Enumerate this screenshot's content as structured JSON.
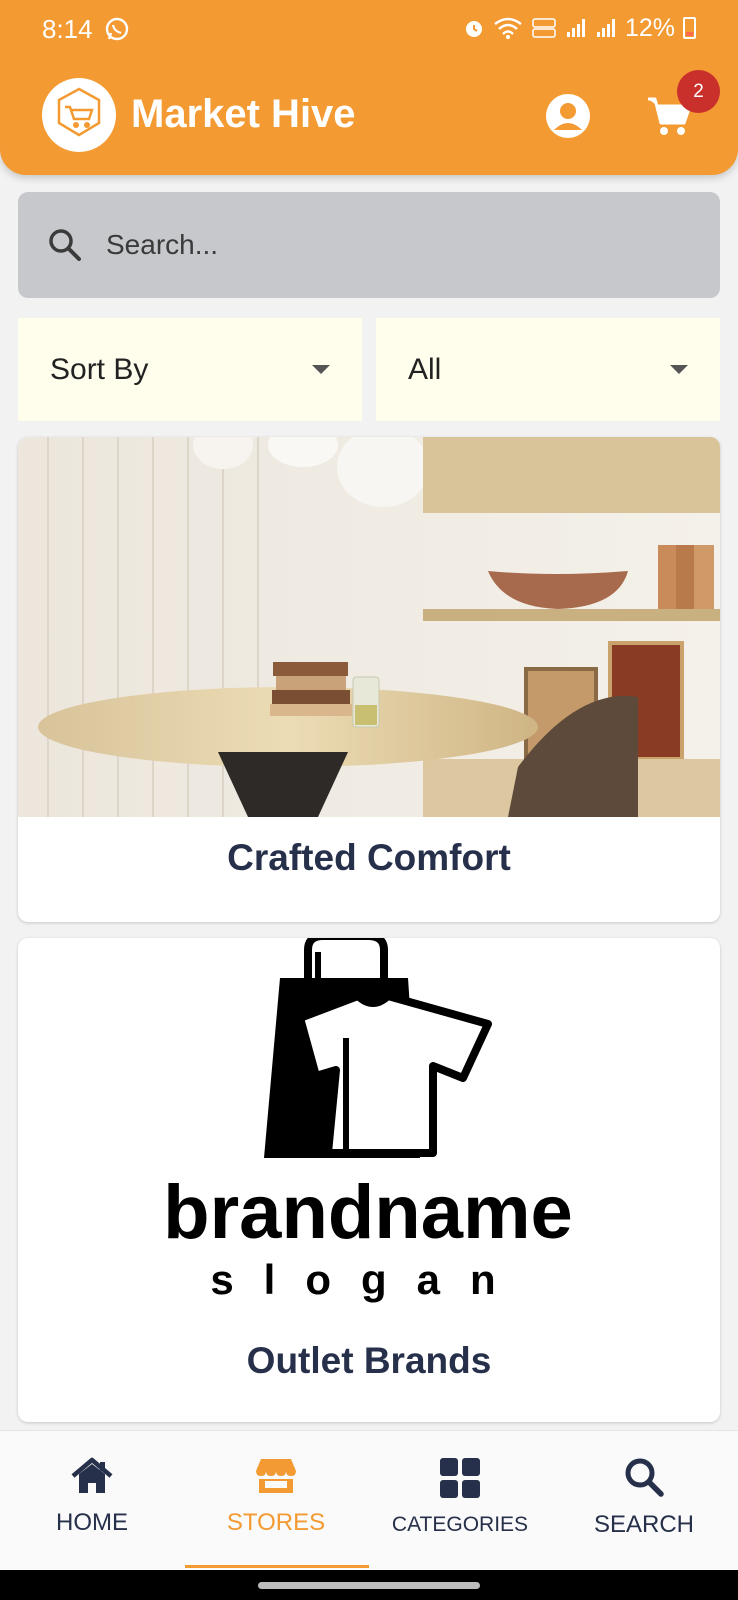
{
  "status_bar": {
    "time": "8:14",
    "battery": "12%"
  },
  "header": {
    "app_title": "Market Hive",
    "cart_count": "2"
  },
  "search": {
    "placeholder": "Search..."
  },
  "filters": {
    "sort_label": "Sort By",
    "category_label": "All"
  },
  "stores": [
    {
      "name": "Crafted Comfort"
    },
    {
      "name": "Outlet Brands",
      "logo_text": "brandname",
      "logo_slogan": "slogan"
    }
  ],
  "bottom_nav": [
    {
      "label": "HOME",
      "icon": "home-icon"
    },
    {
      "label": "STORES",
      "icon": "store-icon",
      "active": true
    },
    {
      "label": "CATEGORIES",
      "icon": "grid-icon"
    },
    {
      "label": "SEARCH",
      "icon": "search-icon"
    }
  ],
  "colors": {
    "accent": "#f39a32",
    "text_dark": "#27304a",
    "badge": "#c9302c",
    "filter_bg": "#fffdeb"
  }
}
